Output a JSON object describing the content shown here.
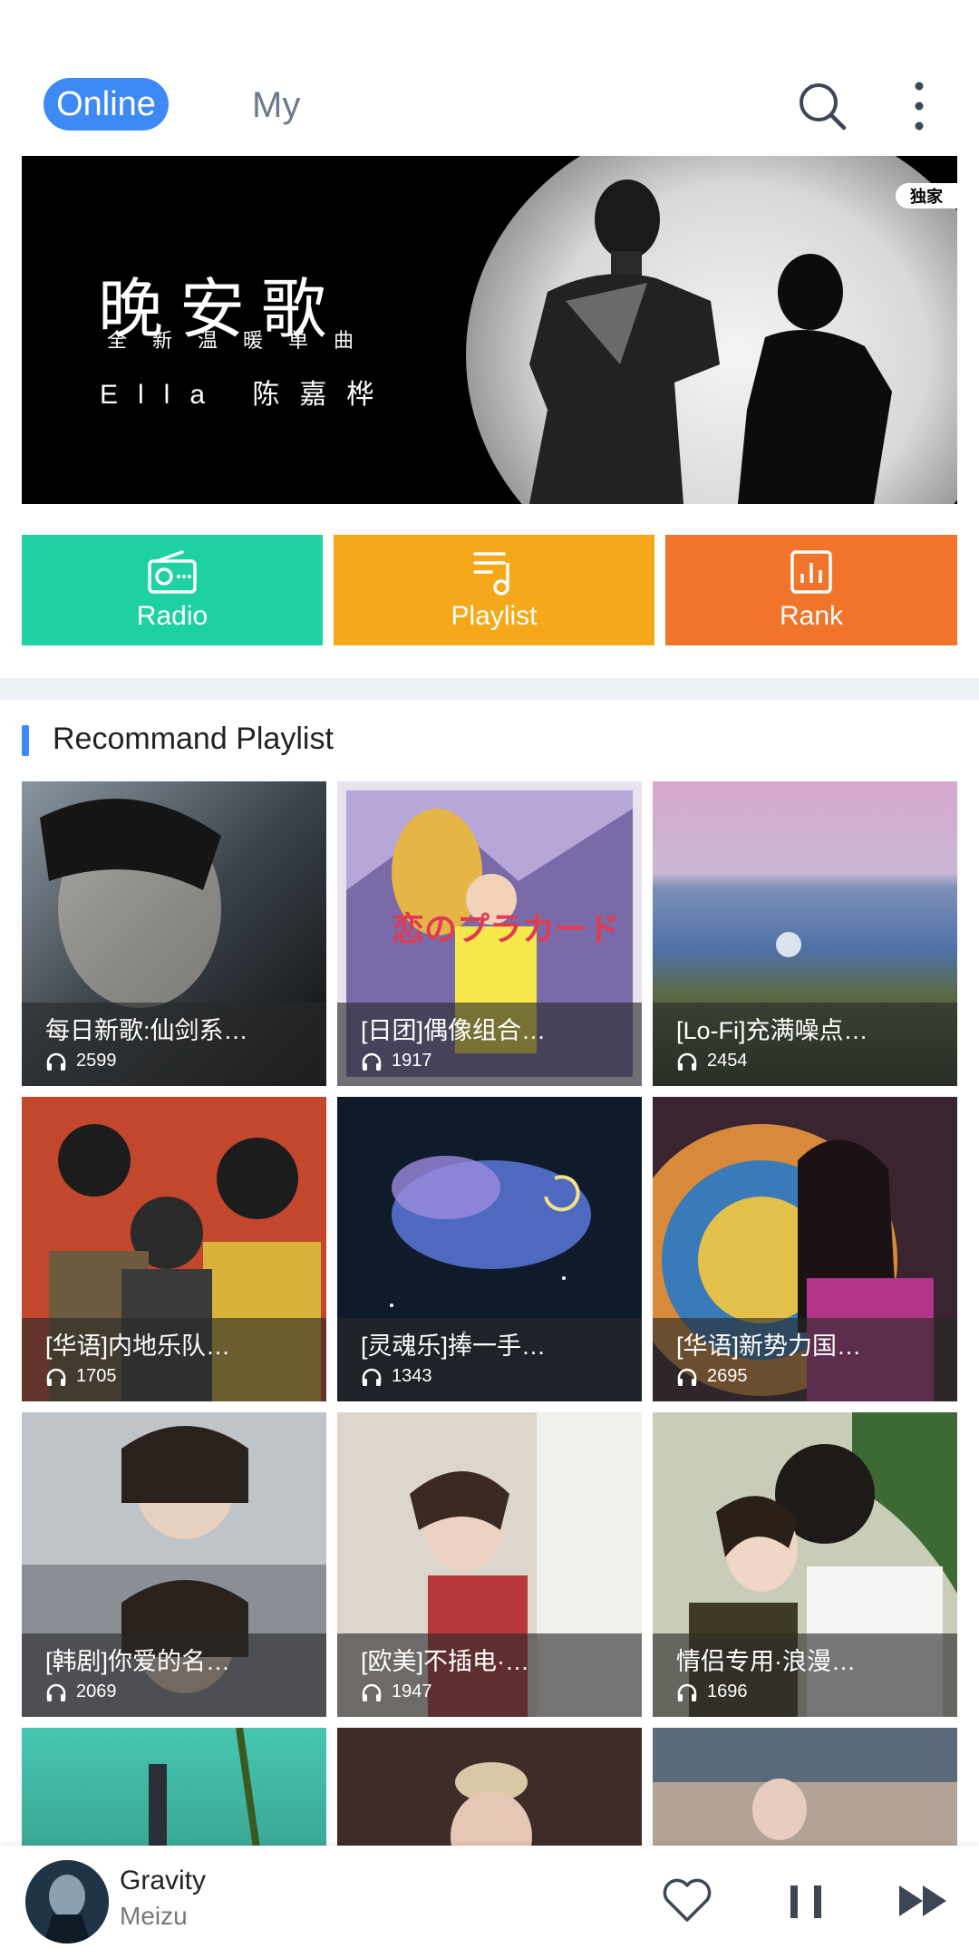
{
  "header": {
    "tabs": [
      {
        "label": "Online",
        "active": true
      },
      {
        "label": "My",
        "active": false
      }
    ],
    "icons": [
      "search-icon",
      "more-vertical-icon"
    ]
  },
  "banner": {
    "title": "晚安歌",
    "subtitle": "全新温暖单曲",
    "artist": "Ella 陈嘉桦",
    "badge": "独家"
  },
  "categories": [
    {
      "label": "Radio",
      "icon": "radio-icon",
      "color": "#1dd1a2"
    },
    {
      "label": "Playlist",
      "icon": "playlist-icon",
      "color": "#f5a91a"
    },
    {
      "label": "Rank",
      "icon": "chart-icon",
      "color": "#f07429"
    }
  ],
  "section": {
    "title": "Recommand Playlist",
    "accent": "#3d8af7"
  },
  "playlists": [
    {
      "name": "每日新歌:仙剑系…",
      "plays": "2599"
    },
    {
      "name": "[日团]偶像组合…",
      "plays": "1917"
    },
    {
      "name": "[Lo-Fi]充满噪点…",
      "plays": "2454"
    },
    {
      "name": "[华语]内地乐队…",
      "plays": "1705"
    },
    {
      "name": "[灵魂乐]捧一手…",
      "plays": "1343"
    },
    {
      "name": "[华语]新势力国…",
      "plays": "2695"
    },
    {
      "name": "[韩剧]你爱的名…",
      "plays": "2069"
    },
    {
      "name": "[欧美]不插电·…",
      "plays": "1947"
    },
    {
      "name": "情侣专用·浪漫…",
      "plays": "1696"
    }
  ],
  "player": {
    "song": "Gravity",
    "artist": "Meizu",
    "controls": [
      "heart-icon",
      "pause-icon",
      "next-icon"
    ]
  }
}
